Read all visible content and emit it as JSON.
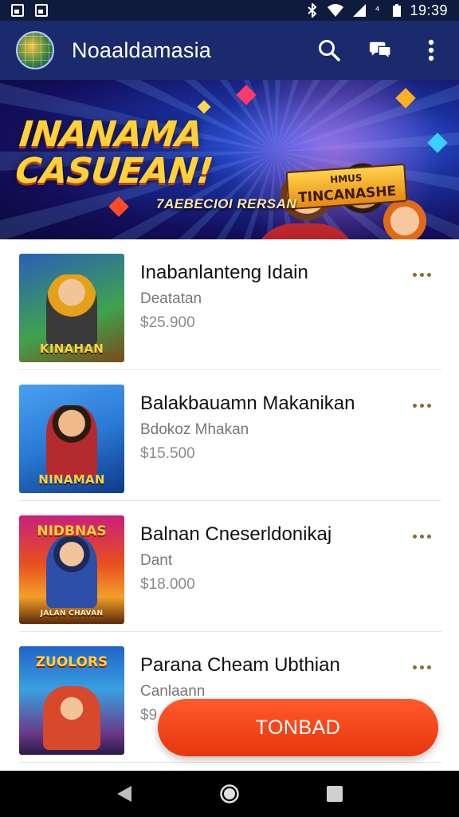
{
  "status_bar": {
    "time": "19:39",
    "icons": [
      "gallery-icon",
      "sd-card-icon",
      "bluetooth-icon",
      "wifi-icon",
      "signal-icon",
      "data-icon",
      "battery-icon"
    ]
  },
  "app_bar": {
    "title": "Noaaldamasia",
    "logo_icon": "app-logo-icon",
    "actions": [
      "search-icon",
      "chat-icon",
      "overflow-menu-icon"
    ]
  },
  "banner": {
    "title": "INANAMA CASUEAN!",
    "subtitle": "7AEBECIOI RERSAN",
    "plate_top": "HMUS",
    "plate_text": "TINCANASHE"
  },
  "games": [
    {
      "title": "Inabanlanteng Idain",
      "subtitle": "Deatatan",
      "price": "$25.900",
      "thumb_label": "KINAHAN",
      "thumb_topline": "",
      "thumb_colors": [
        "#3fa34d",
        "#2a5fb8"
      ],
      "char_color": "#e6a11a"
    },
    {
      "title": "Balakbauamn Makanikan",
      "subtitle": "Bdokoz Mhakan",
      "price": "$15.500",
      "thumb_label": "NINAMAN",
      "thumb_topline": "",
      "thumb_colors": [
        "#2a7ad6",
        "#0f3a8a"
      ],
      "char_color": "#b42a2e"
    },
    {
      "title": "Balnan Cneserldonikaj",
      "subtitle": "Dant",
      "price": "$18.000",
      "thumb_label": "JALAN CHAVAN",
      "thumb_topline": "NIDBNAS",
      "thumb_colors": [
        "#e8501e",
        "#f2a02a"
      ],
      "char_color": "#2e4fa8"
    },
    {
      "title": "Parana Cheam Ubthian",
      "subtitle": "Canlaann",
      "price": "$9",
      "thumb_label": "",
      "thumb_topline": "ZUOLORS",
      "thumb_colors": [
        "#1f63c8",
        "#3aa0e0"
      ],
      "char_color": "#d8482a"
    }
  ],
  "cta": {
    "label": "TONBAD"
  },
  "nav_bar": {
    "buttons": [
      "back-icon",
      "home-icon",
      "recents-icon"
    ]
  }
}
